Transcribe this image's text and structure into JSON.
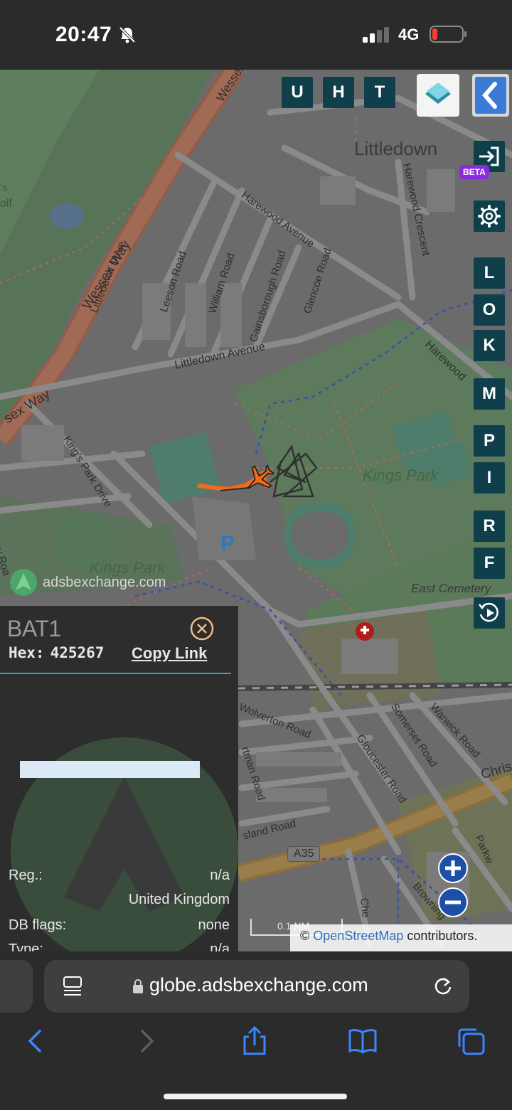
{
  "status_bar": {
    "time": "20:47",
    "network": "4G",
    "silent_icon": "bell-slash-icon",
    "signal_icon": "cellular-signal-icon",
    "battery_icon": "battery-low-icon"
  },
  "map": {
    "labels": {
      "wessex": "Wessex",
      "wessex_way_1": "Wessex Way",
      "wessex_way_2": "sex Way",
      "littledown": "Littledown",
      "littledown_drive": "Littledown Drive",
      "leeson_road": "Leeson Road",
      "william_road": "William Road",
      "gainsborough_road": "Gainsborough Road",
      "glencoe_road": "Glencoe Road",
      "harewood_avenue": "Harewood Avenue",
      "harewood_crescent": "Harewood Crescent",
      "harewood_2": "Harewood",
      "littledown_avenue": "Littledown Avenue",
      "kings_park_drive": "King's Park Drive",
      "kings_park_1": "Kings Park",
      "kings_park_2": "Kings Park",
      "east_cemetery": "East Cemetery",
      "wolverton_road": "Wolverton Road",
      "portman_road": "rtman Road",
      "island_road": "sland Road",
      "somerset_road": "Somerset Road",
      "gloucester_road": "Gloucester Road",
      "warwick_road": "Warwick Road",
      "chris": "Chris",
      "parkw": "Parkw",
      "browning": "Browning",
      "ches": "Che",
      "a35": "A35",
      "parking": "P",
      "ley_road": "ley Roa",
      "golf_s": "'s",
      "golf_olf": "olf"
    },
    "watermark": "adsbexchange.com",
    "scale": "0.1 NM",
    "attribution_prefix": "©",
    "attribution_link": "OpenStreetMap",
    "attribution_suffix": "contributors."
  },
  "toolbar": {
    "top": [
      "U",
      "H",
      "T"
    ],
    "right": [
      "L",
      "O",
      "K",
      "M",
      "P",
      "I",
      "R",
      "F"
    ],
    "beta": "BETA"
  },
  "panel": {
    "callsign": "BAT1",
    "hex_label": "Hex:",
    "hex_value": "425267",
    "copy_link": "Copy Link",
    "rows": [
      {
        "label": "Reg.:",
        "value": "n/a"
      },
      {
        "label": "",
        "value": "United Kingdom"
      },
      {
        "label": "DB flags:",
        "value": "none"
      },
      {
        "label": "Type:",
        "value": "n/a"
      }
    ]
  },
  "browser": {
    "url": "globe.adsbexchange.com"
  },
  "colors": {
    "toolbar_button": "#0e3f4a",
    "track": "#f26a1b",
    "beta": "#8a2be2"
  }
}
